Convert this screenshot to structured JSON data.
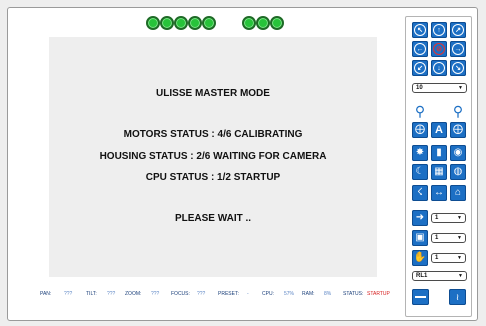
{
  "leds": {
    "group1_count": 5,
    "group2_count": 3,
    "color": "#27c33a"
  },
  "display": {
    "title": "ULISSE MASTER MODE",
    "motors_status": "MOTORS STATUS :  4/6 CALIBRATING",
    "housing_status": "HOUSING STATUS :  2/6 WAITING FOR CAMERA",
    "cpu_status": "CPU STATUS :  1/2 STARTUP",
    "wait_message": "PLEASE WAIT .."
  },
  "statusbar": {
    "pan_label": "PAN:",
    "pan_value": "???",
    "tilt_label": "TILT:",
    "tilt_value": "???",
    "zoom_label": "ZOOM:",
    "zoom_value": "???",
    "focus_label": "FOCUS:",
    "focus_value": "???",
    "preset_label": "PRESET:",
    "preset_value": "-",
    "cpu_label": "CPU:",
    "cpu_value": "57%",
    "ram_label": "RAM:",
    "ram_value": "8%",
    "status_label": "STATUS:",
    "status_value": "STARTUP"
  },
  "controls": {
    "speed_select": "10",
    "preset_select": "1",
    "save_select": "1",
    "auto_select": "1",
    "mode_select": "RL1",
    "accent_color": "#1c6fc4",
    "icons": {
      "move_up_left": "arrow-up-left-icon",
      "move_up": "arrow-up-icon",
      "move_up_right": "arrow-up-right-icon",
      "move_left": "arrow-left-icon",
      "stop": "stop-icon",
      "move_right": "arrow-right-icon",
      "move_down_left": "arrow-down-left-icon",
      "move_down": "arrow-down-icon",
      "move_down_right": "arrow-down-right-icon"
    }
  }
}
